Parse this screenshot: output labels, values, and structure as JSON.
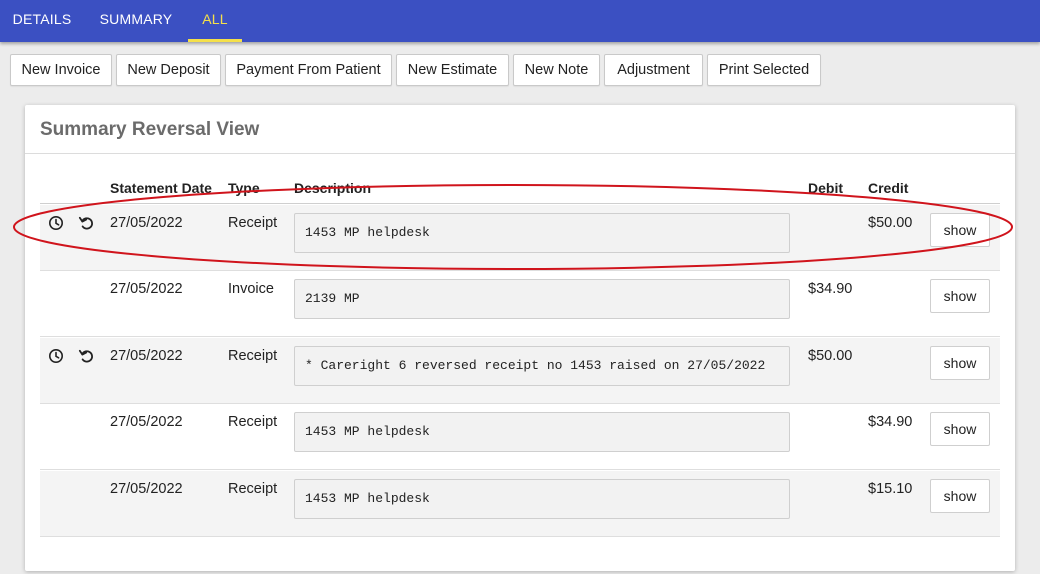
{
  "tabs": [
    {
      "label": "DETAILS",
      "active": false
    },
    {
      "label": "SUMMARY",
      "active": false
    },
    {
      "label": "ALL",
      "active": true
    }
  ],
  "toolbar": {
    "buttons": [
      "New Invoice",
      "New Deposit",
      "Payment From Patient",
      "New Estimate",
      "New Note",
      "Adjustment",
      "Print Selected"
    ]
  },
  "card": {
    "title": "Summary Reversal View",
    "columns": {
      "statement_date": "Statement Date",
      "type": "Type",
      "description": "Description",
      "debit": "Debit",
      "credit": "Credit"
    },
    "rows": [
      {
        "icons": [
          "clock-icon",
          "undo-icon"
        ],
        "date": "27/05/2022",
        "type": "Receipt",
        "description": "1453 MP helpdesk",
        "debit": "",
        "credit": "$50.00",
        "action": "show",
        "highlighted": true
      },
      {
        "icons": [],
        "date": "27/05/2022",
        "type": "Invoice",
        "description": "2139 MP",
        "debit": "$34.90",
        "credit": "",
        "action": "show",
        "highlighted": false
      },
      {
        "icons": [
          "clock-icon",
          "undo-icon"
        ],
        "date": "27/05/2022",
        "type": "Receipt",
        "description": "* Careright 6 reversed receipt no 1453 raised on 27/05/2022",
        "debit": "$50.00",
        "credit": "",
        "action": "show",
        "highlighted": false
      },
      {
        "icons": [],
        "date": "27/05/2022",
        "type": "Receipt",
        "description": "1453 MP helpdesk",
        "debit": "",
        "credit": "$34.90",
        "action": "show",
        "highlighted": false
      },
      {
        "icons": [],
        "date": "27/05/2022",
        "type": "Receipt",
        "description": "1453 MP helpdesk",
        "debit": "",
        "credit": "$15.10",
        "action": "show",
        "highlighted": false
      }
    ]
  },
  "colors": {
    "topbar": "#3b50c2",
    "active_tab": "#f5e04a",
    "annotation": "#d0141c"
  }
}
